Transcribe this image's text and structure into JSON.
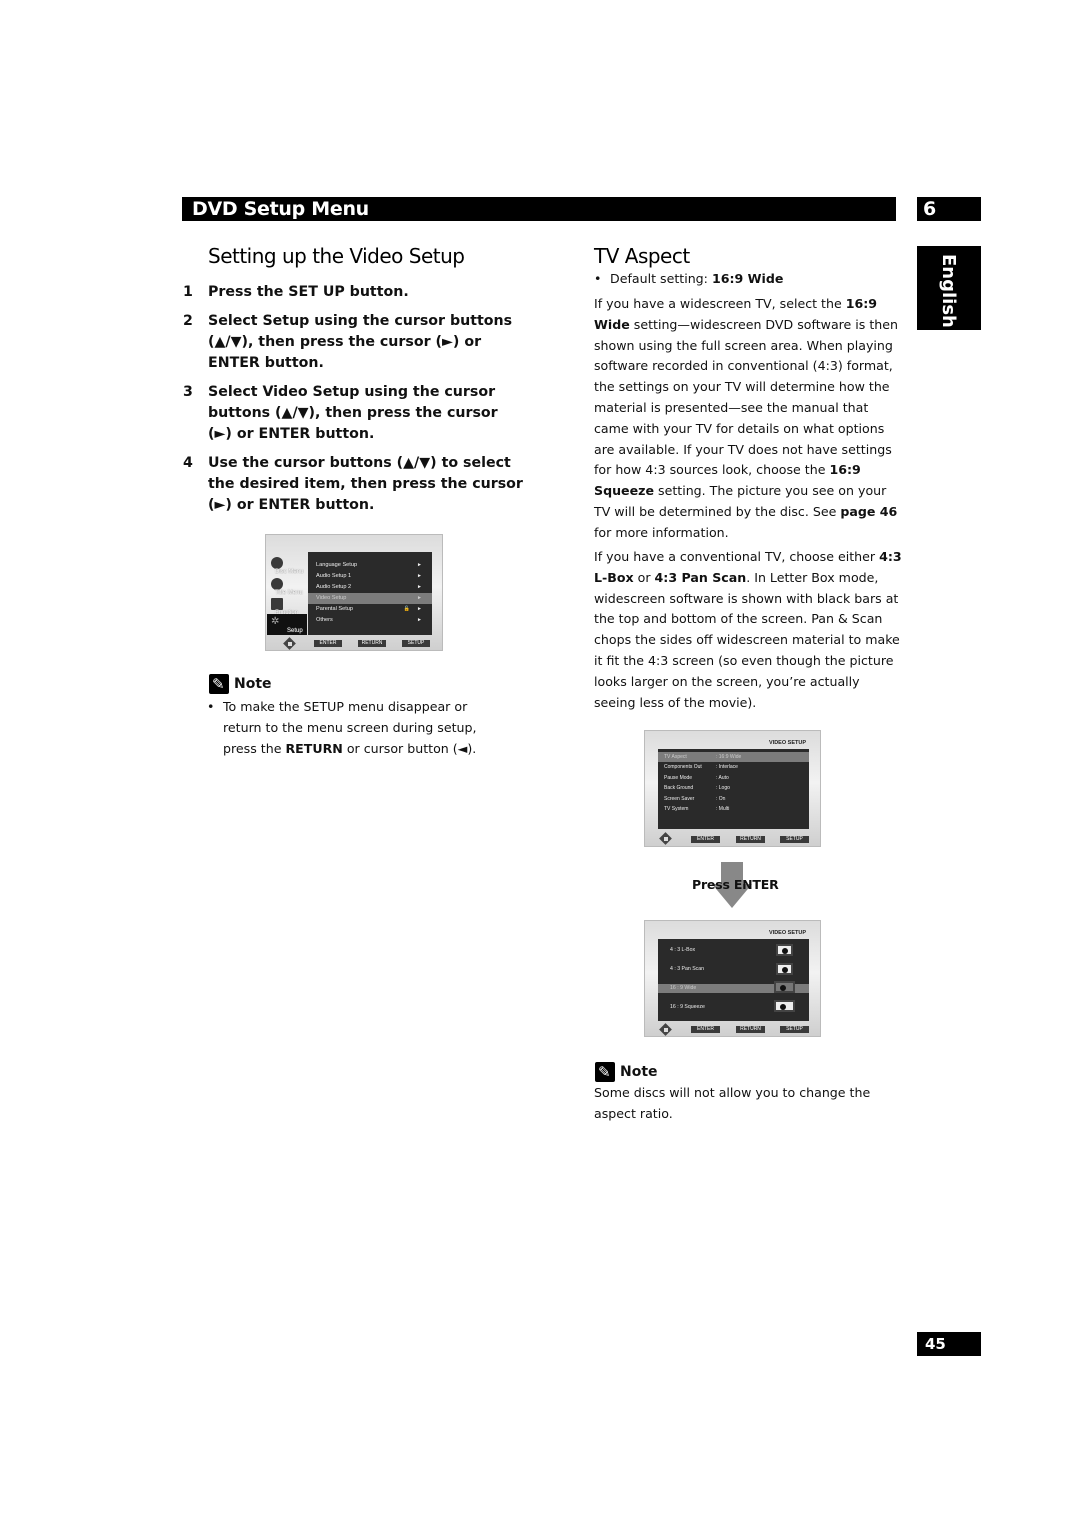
{
  "header": {
    "section_title": "DVD Setup Menu",
    "chapter_number": "6",
    "language_tab": "English"
  },
  "left": {
    "heading": "Setting up the Video Setup",
    "steps": [
      {
        "num": "1",
        "text": "Press the SET UP button."
      },
      {
        "num": "2",
        "text": "Select Setup using the cursor buttons (▲/▼), then press the cursor (►) or ENTER button."
      },
      {
        "num": "3",
        "text": "Select Video Setup using the cursor buttons (▲/▼), then press the cursor (►) or ENTER button."
      },
      {
        "num": "4",
        "text": "Use the cursor buttons (▲/▼) to select the desired item, then press the cursor (►) or ENTER button."
      }
    ],
    "screen1": {
      "side_items": [
        "Disc Menu",
        "Title Menu",
        "Function",
        "Setup"
      ],
      "active_side": "Setup",
      "menu_items": [
        "Language Setup",
        "Audio Setup 1",
        "Audio Setup 2",
        "Video Setup",
        "Parental Setup",
        "Others"
      ],
      "selected_item": "Video Setup",
      "buttons": [
        "ENTER",
        "RETURN",
        "SETUP"
      ]
    },
    "note": {
      "label": "Note",
      "bullet": "•",
      "text_pre": "To make the SETUP menu disappear or return to the menu screen during setup, press the ",
      "text_bold": "RETURN",
      "text_post": " or cursor button (◄)."
    }
  },
  "right": {
    "heading": "TV Aspect",
    "default_bullet": "•",
    "default_label": "Default setting: ",
    "default_value": "16:9 Wide",
    "para1": {
      "a": "If you have a widescreen TV, select the ",
      "b1": "16:9 Wide",
      "c": " setting—widescreen DVD software is then shown using the full screen area. When playing software recorded in conventional (4:3) format, the settings on your TV will determine how the material is presented—see the manual that came with your TV for details on what options are available. If your TV does not have settings for how 4:3 sources look, choose the ",
      "b2": "16:9 Squeeze",
      "d": " setting. The picture you see on your TV will be determined by the disc. See ",
      "b3": "page 46",
      "e": " for more information."
    },
    "para2": {
      "a": "If you have a conventional TV, choose either ",
      "b1": "4:3 L-Box",
      "c": " or ",
      "b2": "4:3 Pan Scan",
      "d": ". In Letter Box mode, widescreen software is shown with black bars at the top and bottom of the screen. Pan & Scan chops the sides off widescreen material to make it fit the 4:3 screen (so even though the picture looks larger on the screen, you’re actually seeing less of the movie)."
    },
    "screen2": {
      "title": "VIDEO SETUP",
      "rows": [
        {
          "key": "TV Aspect",
          "value": ": 16:9  Wide"
        },
        {
          "key": "Components Out",
          "value": ": Interlace"
        },
        {
          "key": "Pause Mode",
          "value": ": Auto"
        },
        {
          "key": "Back Ground",
          "value": ": Logo"
        },
        {
          "key": "Screen Saver",
          "value": ": On"
        },
        {
          "key": "TV System",
          "value": ": Multi"
        }
      ],
      "selected_row": "TV Aspect",
      "buttons": [
        "ENTER",
        "RETURN",
        "SETUP"
      ]
    },
    "press_enter": "Press ENTER",
    "screen3": {
      "title": "VIDEO SETUP",
      "options": [
        "4 : 3 L-Box",
        "4 : 3 Pan Scan",
        "16 : 9  Wide",
        "16 : 9 Squeeze"
      ],
      "selected_option": "16 : 9  Wide",
      "buttons": [
        "ENTER",
        "RETURN",
        "SETUP"
      ]
    },
    "note": {
      "label": "Note",
      "text": "Some discs will not allow you to change the aspect ratio."
    }
  },
  "footer": {
    "page_number": "45"
  }
}
